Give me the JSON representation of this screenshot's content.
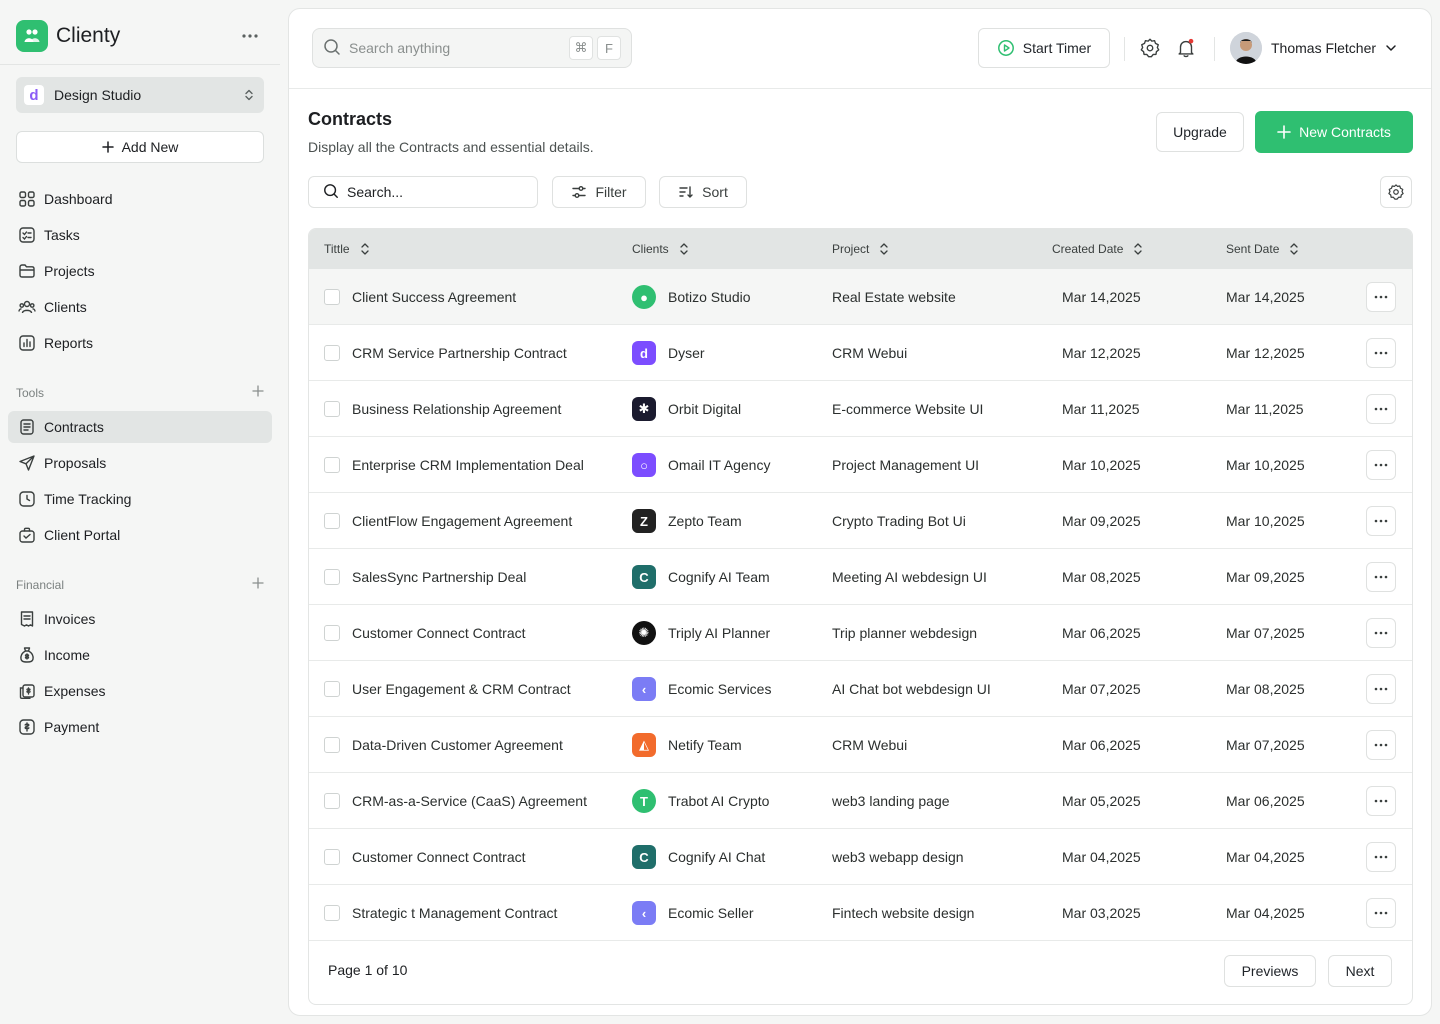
{
  "app": {
    "name": "Clienty",
    "brand_color": "#2fbf71"
  },
  "workspace": {
    "initial": "d",
    "name": "Design Studio"
  },
  "sidebar": {
    "add_new": "Add New",
    "main_items": [
      {
        "label": "Dashboard",
        "icon": "grid-icon"
      },
      {
        "label": "Tasks",
        "icon": "tasks-icon"
      },
      {
        "label": "Projects",
        "icon": "folder-icon"
      },
      {
        "label": "Clients",
        "icon": "users-icon"
      },
      {
        "label": "Reports",
        "icon": "chart-icon"
      }
    ],
    "tools_label": "Tools",
    "tools_items": [
      {
        "label": "Contracts",
        "icon": "document-icon",
        "active": true
      },
      {
        "label": "Proposals",
        "icon": "send-icon"
      },
      {
        "label": "Time Tracking",
        "icon": "clock-icon"
      },
      {
        "label": "Client Portal",
        "icon": "briefcase-icon"
      }
    ],
    "financial_label": "Financial",
    "financial_items": [
      {
        "label": "Invoices",
        "icon": "invoice-icon"
      },
      {
        "label": "Income",
        "icon": "money-bag-icon"
      },
      {
        "label": "Expenses",
        "icon": "expenses-icon"
      },
      {
        "label": "Payment",
        "icon": "payment-icon"
      }
    ]
  },
  "topbar": {
    "search_placeholder": "Search anything",
    "shortcut_cmd": "⌘",
    "shortcut_key": "F",
    "start_timer": "Start Timer",
    "user_name": "Thomas Fletcher"
  },
  "page": {
    "title": "Contracts",
    "subtitle": "Display all the Contracts and essential details.",
    "upgrade": "Upgrade",
    "new_button": "New Contracts",
    "search_placeholder": "Search...",
    "filter": "Filter",
    "sort": "Sort"
  },
  "table": {
    "headers": [
      "Tittle",
      "Clients",
      "Project",
      "Created Date",
      "Sent Date"
    ],
    "rows": [
      {
        "title": "Client Success Agreement",
        "client": "Botizo Studio",
        "logo_color": "#2fbf71",
        "logo_char": "●",
        "round": true,
        "project": "Real Estate website",
        "created": "Mar 14,2025",
        "sent": "Mar 14,2025"
      },
      {
        "title": "CRM Service Partnership Contract",
        "client": "Dyser",
        "logo_color": "#7c4dff",
        "logo_char": "d",
        "round": false,
        "project": "CRM Webui",
        "created": "Mar 12,2025",
        "sent": "Mar 12,2025"
      },
      {
        "title": "Business Relationship Agreement",
        "client": "Orbit Digital",
        "logo_color": "#1b1b2f",
        "logo_char": "✱",
        "round": false,
        "project": "E-commerce Website UI",
        "created": "Mar 11,2025",
        "sent": "Mar 11,2025"
      },
      {
        "title": "Enterprise CRM Implementation Deal",
        "client": "Omail IT Agency",
        "logo_color": "#7c4dff",
        "logo_char": "○",
        "round": false,
        "project": "Project Management UI",
        "created": "Mar 10,2025",
        "sent": "Mar 10,2025"
      },
      {
        "title": "ClientFlow Engagement Agreement",
        "client": "Zepto Team",
        "logo_color": "#222222",
        "logo_char": "Z",
        "round": false,
        "project": "Crypto Trading Bot Ui",
        "created": "Mar 09,2025",
        "sent": "Mar 10,2025"
      },
      {
        "title": "SalesSync Partnership Deal",
        "client": "Cognify AI Team",
        "logo_color": "#1f6e6a",
        "logo_char": "C",
        "round": false,
        "project": "Meeting AI webdesign UI",
        "created": "Mar 08,2025",
        "sent": "Mar 09,2025"
      },
      {
        "title": "Customer Connect Contract",
        "client": "Triply AI Planner",
        "logo_color": "#111111",
        "logo_char": "✺",
        "round": true,
        "project": "Trip planner webdesign",
        "created": "Mar 06,2025",
        "sent": "Mar 07,2025"
      },
      {
        "title": "User Engagement & CRM Contract",
        "client": "Ecomic Services",
        "logo_color": "#7b7cf5",
        "logo_char": "‹",
        "round": false,
        "project": "AI Chat bot webdesign UI",
        "created": "Mar 07,2025",
        "sent": "Mar 08,2025"
      },
      {
        "title": "Data-Driven Customer  Agreement",
        "client": "Netify Team",
        "logo_color": "#f26b2c",
        "logo_char": "◭",
        "round": false,
        "project": "CRM Webui",
        "created": "Mar 06,2025",
        "sent": "Mar 07,2025"
      },
      {
        "title": "CRM-as-a-Service (CaaS) Agreement",
        "client": "Trabot AI Crypto",
        "logo_color": "#2fbf71",
        "logo_char": "T",
        "round": true,
        "project": "web3 landing page",
        "created": "Mar 05,2025",
        "sent": "Mar 06,2025"
      },
      {
        "title": "Customer Connect Contract",
        "client": "Cognify AI Chat",
        "logo_color": "#1f6e6a",
        "logo_char": "C",
        "round": false,
        "project": "web3 webapp design",
        "created": "Mar 04,2025",
        "sent": "Mar 04,2025"
      },
      {
        "title": "Strategic t Management Contract",
        "client": "Ecomic Seller",
        "logo_color": "#7b7cf5",
        "logo_char": "‹",
        "round": false,
        "project": "Fintech website design",
        "created": "Mar 03,2025",
        "sent": "Mar 04,2025"
      }
    ]
  },
  "pagination": {
    "info": "Page 1 of 10",
    "prev": "Previews",
    "next": "Next"
  }
}
